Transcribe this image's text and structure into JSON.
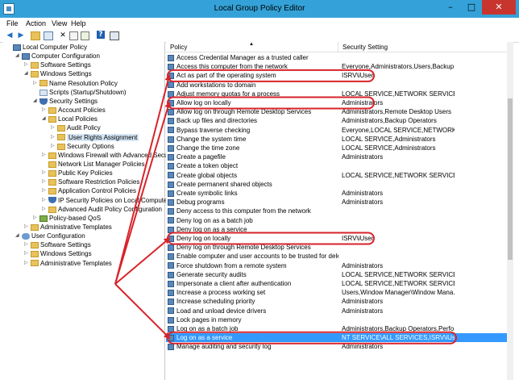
{
  "window": {
    "title": "Local Group Policy Editor",
    "minimize": "–",
    "maximize": "□",
    "close": "✕"
  },
  "menu": [
    "File",
    "Action",
    "View",
    "Help"
  ],
  "toolbar": [
    "back-icon",
    "forward-icon",
    "folder-up-icon",
    "show-hide-tree-icon",
    "delete-icon",
    "properties-icon",
    "export-icon",
    "help-icon",
    "console-icon"
  ],
  "tree": [
    {
      "label": "Local Computer Policy",
      "level": 0,
      "icon": "computer",
      "exp": ""
    },
    {
      "label": "Computer Configuration",
      "level": 1,
      "icon": "computer",
      "exp": "◢"
    },
    {
      "label": "Software Settings",
      "level": 2,
      "icon": "folder",
      "exp": "▷"
    },
    {
      "label": "Windows Settings",
      "level": 2,
      "icon": "folder",
      "exp": "◢"
    },
    {
      "label": "Name Resolution Policy",
      "level": 3,
      "icon": "folder",
      "exp": "▷"
    },
    {
      "label": "Scripts (Startup/Shutdown)",
      "level": 3,
      "icon": "doc",
      "exp": ""
    },
    {
      "label": "Security Settings",
      "level": 3,
      "icon": "shield",
      "exp": "◢"
    },
    {
      "label": "Account Policies",
      "level": 4,
      "icon": "folder",
      "exp": "▷"
    },
    {
      "label": "Local Policies",
      "level": 4,
      "icon": "folder",
      "exp": "◢"
    },
    {
      "label": "Audit Policy",
      "level": 5,
      "icon": "folder",
      "exp": "▷"
    },
    {
      "label": "User Rights Assignment",
      "level": 5,
      "icon": "folder",
      "exp": "▷",
      "selected": true
    },
    {
      "label": "Security Options",
      "level": 5,
      "icon": "folder",
      "exp": "▷"
    },
    {
      "label": "Windows Firewall with Advanced Security",
      "level": 4,
      "icon": "folder",
      "exp": "▷"
    },
    {
      "label": "Network List Manager Policies",
      "level": 4,
      "icon": "folder",
      "exp": ""
    },
    {
      "label": "Public Key Policies",
      "level": 4,
      "icon": "folder",
      "exp": "▷"
    },
    {
      "label": "Software Restriction Policies",
      "level": 4,
      "icon": "folder",
      "exp": "▷"
    },
    {
      "label": "Application Control Policies",
      "level": 4,
      "icon": "folder",
      "exp": "▷"
    },
    {
      "label": "IP Security Policies on Local Computer",
      "level": 4,
      "icon": "shield",
      "exp": "▷"
    },
    {
      "label": "Advanced Audit Policy Configuration",
      "level": 4,
      "icon": "folder",
      "exp": "▷"
    },
    {
      "label": "Policy-based QoS",
      "level": 3,
      "icon": "chart",
      "exp": "▷"
    },
    {
      "label": "Administrative Templates",
      "level": 2,
      "icon": "folder",
      "exp": "▷"
    },
    {
      "label": "User Configuration",
      "level": 1,
      "icon": "user",
      "exp": "◢"
    },
    {
      "label": "Software Settings",
      "level": 2,
      "icon": "folder",
      "exp": "▷"
    },
    {
      "label": "Windows Settings",
      "level": 2,
      "icon": "folder",
      "exp": "▷"
    },
    {
      "label": "Administrative Templates",
      "level": 2,
      "icon": "folder",
      "exp": "▷"
    }
  ],
  "columns": {
    "policy": "Policy",
    "setting": "Security Setting",
    "sort_glyph": "▲"
  },
  "rows": [
    {
      "policy": "Access Credential Manager as a trusted caller",
      "setting": ""
    },
    {
      "policy": "Access this computer from the network",
      "setting": "Everyone,Administrators,Users,Backup ..."
    },
    {
      "policy": "Act as part of the operating system",
      "setting": "ISRV\\iUser",
      "circled": true
    },
    {
      "policy": "Add workstations to domain",
      "setting": ""
    },
    {
      "policy": "Adjust memory quotas for a process",
      "setting": "LOCAL SERVICE,NETWORK SERVICE,Ad..."
    },
    {
      "policy": "Allow log on locally",
      "setting": "Administrators",
      "circled": true
    },
    {
      "policy": "Allow log on through Remote Desktop Services",
      "setting": "Administrators,Remote Desktop Users"
    },
    {
      "policy": "Back up files and directories",
      "setting": "Administrators,Backup Operators"
    },
    {
      "policy": "Bypass traverse checking",
      "setting": "Everyone,LOCAL SERVICE,NETWORK S..."
    },
    {
      "policy": "Change the system time",
      "setting": "LOCAL SERVICE,Administrators"
    },
    {
      "policy": "Change the time zone",
      "setting": "LOCAL SERVICE,Administrators"
    },
    {
      "policy": "Create a pagefile",
      "setting": "Administrators"
    },
    {
      "policy": "Create a token object",
      "setting": ""
    },
    {
      "policy": "Create global objects",
      "setting": "LOCAL SERVICE,NETWORK SERVICE,Ad..."
    },
    {
      "policy": "Create permanent shared objects",
      "setting": ""
    },
    {
      "policy": "Create symbolic links",
      "setting": "Administrators"
    },
    {
      "policy": "Debug programs",
      "setting": "Administrators"
    },
    {
      "policy": "Deny access to this computer from the network",
      "setting": ""
    },
    {
      "policy": "Deny log on as a batch job",
      "setting": ""
    },
    {
      "policy": "Deny log on as a service",
      "setting": ""
    },
    {
      "policy": "Deny log on locally",
      "setting": "ISRV\\iUser",
      "circled": true
    },
    {
      "policy": "Deny log on through Remote Desktop Services",
      "setting": ""
    },
    {
      "policy": "Enable computer and user accounts to be trusted for delega...",
      "setting": ""
    },
    {
      "policy": "Force shutdown from a remote system",
      "setting": "Administrators"
    },
    {
      "policy": "Generate security audits",
      "setting": "LOCAL SERVICE,NETWORK SERVICE"
    },
    {
      "policy": "Impersonate a client after authentication",
      "setting": "LOCAL SERVICE,NETWORK SERVICE,Ad..."
    },
    {
      "policy": "Increase a process working set",
      "setting": "Users,Window Manager\\Window Mana..."
    },
    {
      "policy": "Increase scheduling priority",
      "setting": "Administrators"
    },
    {
      "policy": "Load and unload device drivers",
      "setting": "Administrators"
    },
    {
      "policy": "Lock pages in memory",
      "setting": ""
    },
    {
      "policy": "Log on as a batch job",
      "setting": "Administrators,Backup Operators,Perfo..."
    },
    {
      "policy": "Log on as a service",
      "setting": "NT SERVICE\\ALL SERVICES,ISRV\\iUser",
      "circled": true,
      "selected": true
    },
    {
      "policy": "Manage auditing and security log",
      "setting": "Administrators"
    }
  ],
  "annotation_color": "#d8232a"
}
